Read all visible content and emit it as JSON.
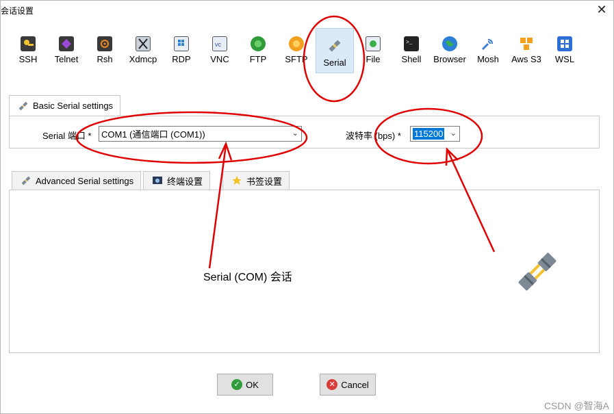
{
  "window": {
    "title": "会话设置",
    "close_glyph": "✕"
  },
  "session_types": [
    {
      "label": "SSH",
      "icon": "ssh-icon",
      "color": "#3a3a3a"
    },
    {
      "label": "Telnet",
      "icon": "telnet-icon",
      "color": "#6a2a8a"
    },
    {
      "label": "Rsh",
      "icon": "rsh-icon",
      "color": "#3a3a3a"
    },
    {
      "label": "Xdmcp",
      "icon": "xdmcp-icon",
      "color": "#9aa4b0"
    },
    {
      "label": "RDP",
      "icon": "rdp-icon",
      "color": "#4a8fd6"
    },
    {
      "label": "VNC",
      "icon": "vnc-icon",
      "color": "#6a8fd6"
    },
    {
      "label": "FTP",
      "icon": "ftp-icon",
      "color": "#2e9d3a"
    },
    {
      "label": "SFTP",
      "icon": "sftp-icon",
      "color": "#f2a020"
    },
    {
      "label": "Serial",
      "icon": "serial-plug-icon",
      "color": "#7d8a95",
      "selected": true
    },
    {
      "label": "File",
      "icon": "file-icon",
      "color": "#4aa0d8"
    },
    {
      "label": "Shell",
      "icon": "shell-icon",
      "color": "#222222"
    },
    {
      "label": "Browser",
      "icon": "browser-icon",
      "color": "#2e9d3a"
    },
    {
      "label": "Mosh",
      "icon": "mosh-icon",
      "color": "#3a7bd6"
    },
    {
      "label": "Aws S3",
      "icon": "aws-s3-icon",
      "color": "#f2a020"
    },
    {
      "label": "WSL",
      "icon": "wsl-icon",
      "color": "#2e6fd6"
    }
  ],
  "basic_tab": {
    "label": "Basic Serial settings"
  },
  "basic": {
    "port_label": "Serial 端口 *",
    "port_value": "COM1  (通信端口 (COM1))",
    "baud_label": "波特率 (bps) *",
    "baud_value": "115200"
  },
  "advanced_tabs": [
    {
      "label": "Advanced Serial settings"
    },
    {
      "label": "终端设置"
    },
    {
      "label": "书签设置"
    }
  ],
  "annotation": {
    "text": "Serial (COM) 会话"
  },
  "buttons": {
    "ok": "OK",
    "cancel": "Cancel"
  },
  "watermark": "CSDN @智海A",
  "colors": {
    "annotation_red": "#e00000",
    "selection_blue": "#0078d7",
    "ok_green": "#2e9d3a",
    "cancel_red": "#d93a3a"
  }
}
